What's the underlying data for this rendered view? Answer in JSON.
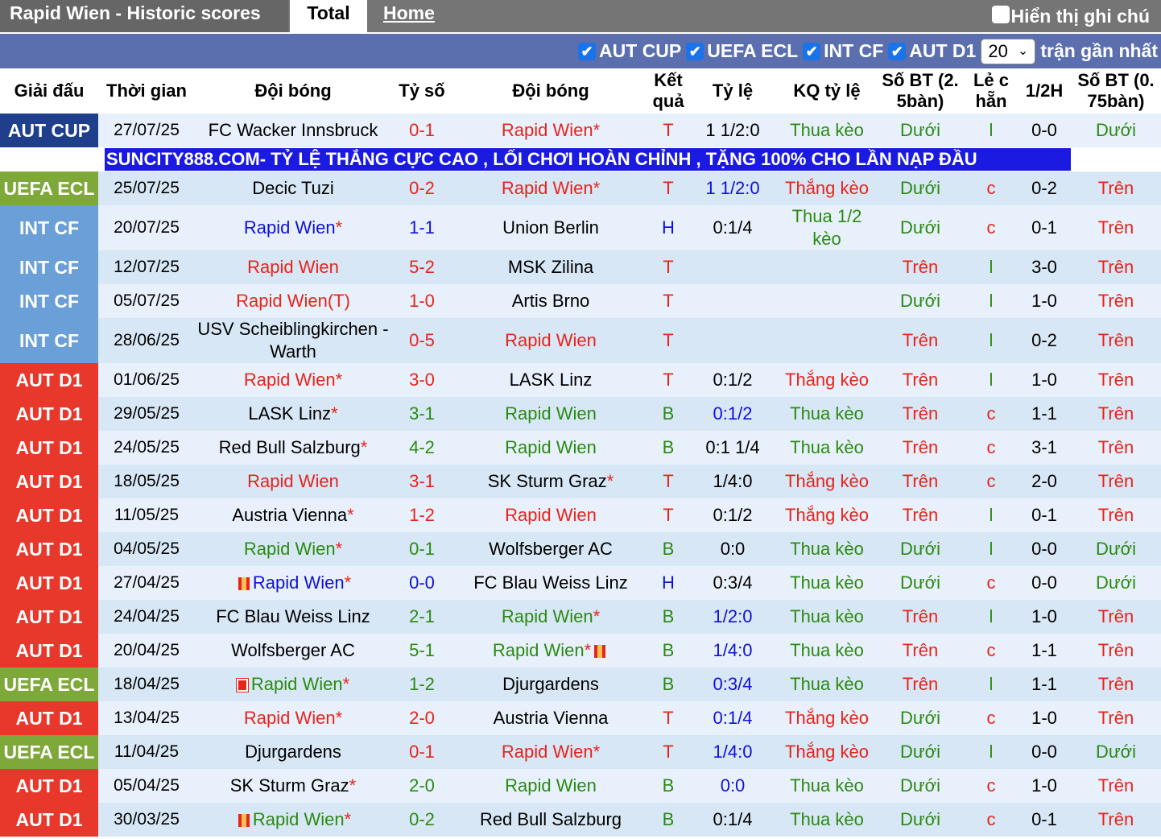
{
  "header": {
    "title": "Rapid Wien - Historic scores",
    "tab_total": "Total",
    "tab_home": "Home",
    "notes_label": "Hiển thị ghi chú"
  },
  "filters": {
    "items": [
      "AUT CUP",
      "UEFA ECL",
      "INT CF",
      "AUT D1"
    ],
    "count_value": "20",
    "count_suffix": "trận gần nhất"
  },
  "columns": [
    "Giải đấu",
    "Thời gian",
    "Đội bóng",
    "Tỷ số",
    "Đội bóng",
    "Kết quả",
    "Tỷ lệ",
    "KQ tỷ lệ",
    "Số BT (2. 5bàn)",
    "Lẻ c hẵn",
    "1/2H",
    "Số BT (0. 75bàn)"
  ],
  "promo": "SUNCITY888.COM- TỶ LỆ THẮNG CỰC CAO , LỐI CHƠI HOÀN CHỈNH , TẶNG 100% CHO LẦN NẠP ĐẦU",
  "colors": {
    "aut_cup": "#1f3e8c",
    "uefa_ecl": "#7fa83a",
    "int_cf": "#6a9fd8",
    "aut_d1": "#e8382b",
    "red": "#e8231b",
    "blue": "#1010d8",
    "green": "#2a8a12"
  },
  "rows": [
    {
      "league": "AUT CUP",
      "date": "27/07/25",
      "home": "FC Wacker Innsbruck",
      "home_star": "",
      "score": "0-1",
      "away": "Rapid Wien",
      "away_star": "*",
      "result": "T",
      "odds": "1 1/2:0",
      "odds_result": "Thua kèo",
      "ou": "Dưới",
      "oe": "l",
      "half": "0-0",
      "ou2": "Dưới"
    },
    {
      "league": "UEFA ECL",
      "date": "25/07/25",
      "home": "Decic Tuzi",
      "home_star": "",
      "score": "0-2",
      "away": "Rapid Wien",
      "away_star": "*",
      "result": "T",
      "odds": "1 1/2:0",
      "odds_result": "Thắng kèo",
      "ou": "Dưới",
      "oe": "c",
      "half": "0-2",
      "ou2": "Trên"
    },
    {
      "league": "INT CF",
      "date": "20/07/25",
      "home": "Rapid Wien",
      "home_star": "*",
      "score": "1-1",
      "away": "Union Berlin",
      "away_star": "",
      "result": "H",
      "odds": "0:1/4",
      "odds_result": "Thua 1/2 kèo",
      "ou": "Dưới",
      "oe": "c",
      "half": "0-1",
      "ou2": "Trên"
    },
    {
      "league": "INT CF",
      "date": "12/07/25",
      "home": "Rapid Wien",
      "home_star": "",
      "score": "5-2",
      "away": "MSK Zilina",
      "away_star": "",
      "result": "T",
      "odds": "",
      "odds_result": "",
      "ou": "Trên",
      "oe": "l",
      "half": "3-0",
      "ou2": "Trên"
    },
    {
      "league": "INT CF",
      "date": "05/07/25",
      "home": "Rapid Wien",
      "home_star": "(T)",
      "score": "1-0",
      "away": "Artis Brno",
      "away_star": "",
      "result": "T",
      "odds": "",
      "odds_result": "",
      "ou": "Dưới",
      "oe": "l",
      "half": "1-0",
      "ou2": "Trên"
    },
    {
      "league": "INT CF",
      "date": "28/06/25",
      "home": "USV Scheiblingkirchen -Warth",
      "home_star": "",
      "score": "0-5",
      "away": "Rapid Wien",
      "away_star": "",
      "result": "T",
      "odds": "",
      "odds_result": "",
      "ou": "Trên",
      "oe": "l",
      "half": "0-2",
      "ou2": "Trên"
    },
    {
      "league": "AUT D1",
      "date": "01/06/25",
      "home": "Rapid Wien",
      "home_star": "*",
      "score": "3-0",
      "away": "LASK Linz",
      "away_star": "",
      "result": "T",
      "odds": "0:1/2",
      "odds_result": "Thắng kèo",
      "ou": "Trên",
      "oe": "l",
      "half": "1-0",
      "ou2": "Trên"
    },
    {
      "league": "AUT D1",
      "date": "29/05/25",
      "home": "LASK Linz",
      "home_star": "*",
      "score": "3-1",
      "away": "Rapid Wien",
      "away_star": "",
      "result": "B",
      "odds": "0:1/2",
      "odds_result": "Thua kèo",
      "ou": "Trên",
      "oe": "c",
      "half": "1-1",
      "ou2": "Trên"
    },
    {
      "league": "AUT D1",
      "date": "24/05/25",
      "home": "Red Bull Salzburg",
      "home_star": "*",
      "score": "4-2",
      "away": "Rapid Wien",
      "away_star": "",
      "result": "B",
      "odds": "0:1 1/4",
      "odds_result": "Thua kèo",
      "ou": "Trên",
      "oe": "c",
      "half": "3-1",
      "ou2": "Trên"
    },
    {
      "league": "AUT D1",
      "date": "18/05/25",
      "home": "Rapid Wien",
      "home_star": "",
      "score": "3-1",
      "away": "SK Sturm Graz",
      "away_star": "*",
      "result": "T",
      "odds": "1/4:0",
      "odds_result": "Thắng kèo",
      "ou": "Trên",
      "oe": "c",
      "half": "2-0",
      "ou2": "Trên"
    },
    {
      "league": "AUT D1",
      "date": "11/05/25",
      "home": "Austria Vienna",
      "home_star": "*",
      "score": "1-2",
      "away": "Rapid Wien",
      "away_star": "",
      "result": "T",
      "odds": "0:1/2",
      "odds_result": "Thắng kèo",
      "ou": "Trên",
      "oe": "l",
      "half": "0-1",
      "ou2": "Trên"
    },
    {
      "league": "AUT D1",
      "date": "04/05/25",
      "home": "Rapid Wien",
      "home_star": "*",
      "score": "0-1",
      "away": "Wolfsberger AC",
      "away_star": "",
      "result": "B",
      "odds": "0:0",
      "odds_result": "Thua kèo",
      "ou": "Dưới",
      "oe": "l",
      "half": "0-0",
      "ou2": "Dưới"
    },
    {
      "league": "AUT D1",
      "date": "27/04/25",
      "home": "Rapid Wien",
      "home_star": "*",
      "score": "0-0",
      "away": "FC Blau Weiss Linz",
      "away_star": "",
      "result": "H",
      "odds": "0:3/4",
      "odds_result": "Thua kèo",
      "ou": "Dưới",
      "oe": "c",
      "half": "0-0",
      "ou2": "Dưới"
    },
    {
      "league": "AUT D1",
      "date": "24/04/25",
      "home": "FC Blau Weiss Linz",
      "home_star": "",
      "score": "2-1",
      "away": "Rapid Wien",
      "away_star": "*",
      "result": "B",
      "odds": "1/2:0",
      "odds_result": "Thua kèo",
      "ou": "Trên",
      "oe": "l",
      "half": "1-0",
      "ou2": "Trên"
    },
    {
      "league": "AUT D1",
      "date": "20/04/25",
      "home": "Wolfsberger AC",
      "home_star": "",
      "score": "5-1",
      "away": "Rapid Wien",
      "away_star": "*",
      "result": "B",
      "odds": "1/4:0",
      "odds_result": "Thua kèo",
      "ou": "Trên",
      "oe": "c",
      "half": "1-1",
      "ou2": "Trên"
    },
    {
      "league": "UEFA ECL",
      "date": "18/04/25",
      "home": "Rapid Wien",
      "home_star": "*",
      "score": "1-2",
      "away": "Djurgardens",
      "away_star": "",
      "result": "B",
      "odds": "0:3/4",
      "odds_result": "Thua kèo",
      "ou": "Trên",
      "oe": "l",
      "half": "1-1",
      "ou2": "Trên"
    },
    {
      "league": "AUT D1",
      "date": "13/04/25",
      "home": "Rapid Wien",
      "home_star": "*",
      "score": "2-0",
      "away": "Austria Vienna",
      "away_star": "",
      "result": "T",
      "odds": "0:1/4",
      "odds_result": "Thắng kèo",
      "ou": "Dưới",
      "oe": "c",
      "half": "1-0",
      "ou2": "Trên"
    },
    {
      "league": "UEFA ECL",
      "date": "11/04/25",
      "home": "Djurgardens",
      "home_star": "",
      "score": "0-1",
      "away": "Rapid Wien",
      "away_star": "*",
      "result": "T",
      "odds": "1/4:0",
      "odds_result": "Thắng kèo",
      "ou": "Dưới",
      "oe": "l",
      "half": "0-0",
      "ou2": "Dưới"
    },
    {
      "league": "AUT D1",
      "date": "05/04/25",
      "home": "SK Sturm Graz",
      "home_star": "*",
      "score": "2-0",
      "away": "Rapid Wien",
      "away_star": "",
      "result": "B",
      "odds": "0:0",
      "odds_result": "Thua kèo",
      "ou": "Dưới",
      "oe": "c",
      "half": "1-0",
      "ou2": "Trên"
    },
    {
      "league": "AUT D1",
      "date": "30/03/25",
      "home": "Rapid Wien",
      "home_star": "*",
      "score": "0-2",
      "away": "Red Bull Salzburg",
      "away_star": "",
      "result": "B",
      "odds": "0:1/4",
      "odds_result": "Thua kèo",
      "ou": "Dưới",
      "oe": "c",
      "half": "0-1",
      "ou2": "Trên"
    }
  ]
}
